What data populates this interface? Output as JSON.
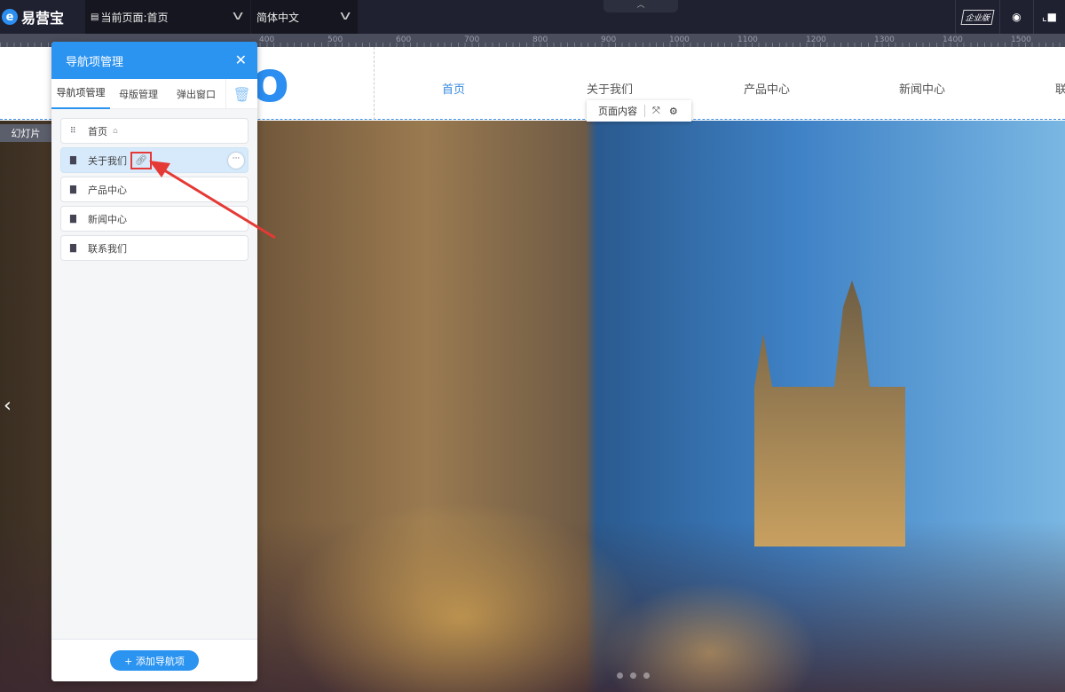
{
  "topbar": {
    "logo": "易营宝",
    "logo_mark": "e",
    "current_page": "当前页面:首页",
    "language": "简体中文",
    "edition_badge": "企业版"
  },
  "ruler": {
    "labels": [
      "400",
      "500",
      "600",
      "700",
      "800",
      "900",
      "1000",
      "1100",
      "1200",
      "1300",
      "1400",
      "1500"
    ]
  },
  "site": {
    "logo_partial": "o",
    "nav": [
      "首页",
      "关于我们",
      "产品中心",
      "新闻中心",
      "联"
    ],
    "active_nav": 0,
    "toolbar_label": "页面内容"
  },
  "slide": {
    "label": "幻灯片",
    "prev": "‹"
  },
  "panel": {
    "title": "导航项管理",
    "tabs": [
      "导航项管理",
      "母版管理",
      "弹出窗口"
    ],
    "active_tab": 0,
    "items": [
      {
        "label": "首页",
        "icon": "grid-icon",
        "home": true
      },
      {
        "label": "关于我们",
        "icon": "page-icon",
        "selected": true,
        "link": true
      },
      {
        "label": "产品中心",
        "icon": "page-icon"
      },
      {
        "label": "新闻中心",
        "icon": "page-icon"
      },
      {
        "label": "联系我们",
        "icon": "page-icon"
      }
    ],
    "add_button": "+ 添加导航项"
  },
  "colors": {
    "accent": "#2b93f0",
    "annotation": "#e53935",
    "topbar": "#1f2130"
  }
}
